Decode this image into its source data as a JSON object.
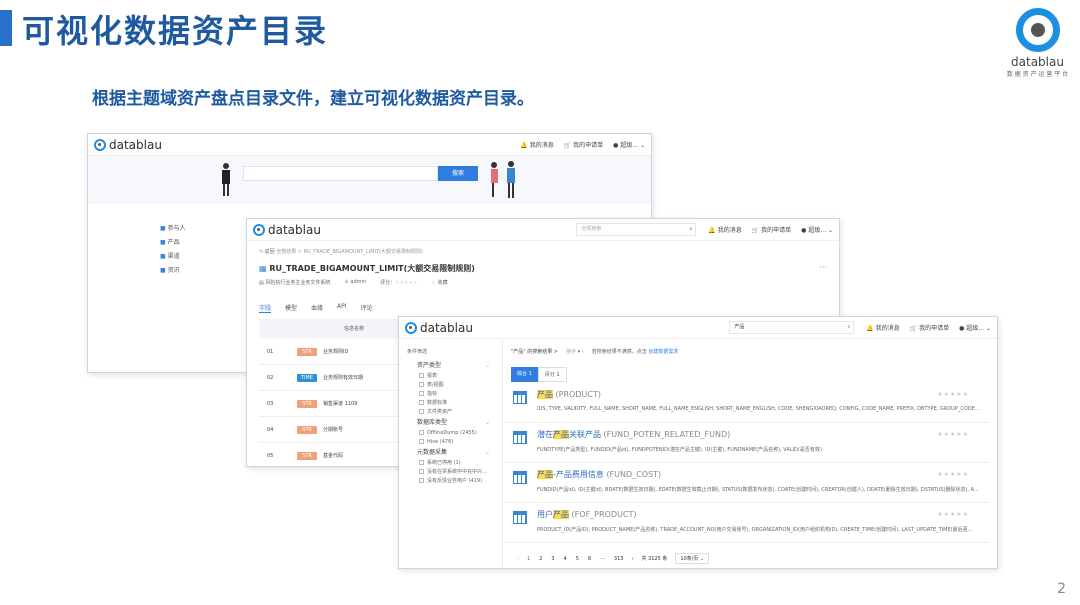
{
  "page": {
    "title": "可视化数据资产目录",
    "subtitle": "根据主题域资产盘点目录文件，建立可视化数据资产目录。",
    "page_number": "2",
    "logo": {
      "name": "datablau",
      "tagline": "数 据 资 产 运 营 平 台"
    }
  },
  "colors": {
    "accent": "#2a72c9",
    "title": "#1f5aa0",
    "brand_blue": "#1d8fe0",
    "button": "#2f7de1",
    "highlight": "#ffd84d"
  },
  "window1": {
    "brand": "datablau",
    "nav": [
      "我的消息",
      "我的申请单",
      "超级..."
    ],
    "search_button": "搜索",
    "sidebar": [
      "参与人",
      "产品",
      "渠道",
      "资讯"
    ]
  },
  "window2": {
    "brand": "datablau",
    "search_placeholder": "全局搜索",
    "nav": [
      "我的消息",
      "我的申请单",
      "超级..."
    ],
    "menu": "···",
    "breadcrumb": {
      "back": "返回",
      "path": "全部结果 > RU_TRADE_BIGAMOUNT_LIMIT(大额交易限制规则)"
    },
    "table_title": "RU_TRADE_BIGAMOUNT_LIMIT(大额交易限制规则)",
    "meta": {
      "source": "风险执行业务主业务文件系统",
      "owner": "admin",
      "rating": "评分：",
      "favorite": "收藏"
    },
    "tabs": [
      "字段",
      "模型",
      "血缘",
      "API",
      "评论"
    ],
    "table_header": "信息名称",
    "rows": [
      {
        "no": "01",
        "type": "STR",
        "name": "业务规则ID",
        "color": "#f0a07a"
      },
      {
        "no": "02",
        "type": "TIME",
        "name": "业务规则有效日期",
        "color": "#2f8fd8"
      },
      {
        "no": "03",
        "type": "STR",
        "name": "销售渠道 1109",
        "color": "#f0a07a"
      },
      {
        "no": "04",
        "type": "STR",
        "name": "分期账号",
        "color": "#f0a07a"
      },
      {
        "no": "05",
        "type": "STR",
        "name": "基金代码",
        "color": "#f0a07a"
      }
    ]
  },
  "window3": {
    "brand": "datablau",
    "search_value": "产品",
    "nav": [
      "我的消息",
      "我的申请单",
      "超级..."
    ],
    "filter_title": "条件筛选",
    "breadcrumb": "\"产品\" 的搜索结果 >",
    "sort": "排序",
    "notice": "若搜索结果不满意，点击",
    "notice_link": "创建数据需求",
    "result_tabs": [
      "综合 1",
      "评分 1"
    ],
    "filters": [
      {
        "title": "资产类型",
        "items": [
          "报表",
          "表/视图",
          "指标",
          "数据标准",
          "文件类资产"
        ]
      },
      {
        "title": "数据库类型",
        "items": [
          "OfflineDump (2455)",
          "Hive (476)"
        ]
      },
      {
        "title": "元数据采集",
        "items": [
          "系统已停用 (1)",
          "没有在票系统中中充中兴...",
          "没有反馈业务用户 (419)"
        ]
      }
    ],
    "results": [
      {
        "pre": "",
        "hl": "产品",
        "post": "",
        "en": "(PRODUCT)",
        "desc": "IDS, TYPE, VALIDITY, FULL_NAME, SHORT_NAME, FULL_NAME_ENGLISH, SHORT_NAME_ENGLISH, CODE, SHENGXIAOREQ, CONFIG, CODE_NAME, PREFIX, DBTYPE, GROUP_CODE..."
      },
      {
        "pre": "潜在",
        "hl": "产品",
        "post": "关联产品",
        "en": "(FUND_POTEN_RELATED_FUND)",
        "desc": "FUNDTYPE(产品类型), FUNDID(产品id), FUNDPOTENID(潜在产品主键), ID(主键), FUNDNAME(产品名称), VALID(是否有效)"
      },
      {
        "pre": "",
        "hl": "产品",
        "post": "-产品费用信息",
        "en": "(FUND_COST)",
        "desc": "FUNDID(产品id), ID(主键id), BDATE(数据生效日期), EDATE(数据生效截止日期), STATUS(数据发布状态), CDATE(创建时间), CREATOR(创建人), DDATE(删除生效日期), DSTATUS(删除状态), A..."
      },
      {
        "pre": "用户",
        "hl": "产品",
        "post": "",
        "en": "(FOF_PRODUCT)",
        "desc": "PRODUCT_ID(产品ID), PRODUCT_NAME(产品名称), TRADE_ACCOUNT_NO(用户交易账号), ORGANIZATION_ID(用户组织机构ID), CREATE_TIME(创建时间), LAST_UPDATE_TIME(最后更..."
      }
    ],
    "pagination": {
      "pages": [
        "1",
        "2",
        "3",
        "4",
        "5",
        "6",
        "···",
        "313"
      ],
      "total": "共 3125 条",
      "page_size": "10条/页"
    }
  }
}
